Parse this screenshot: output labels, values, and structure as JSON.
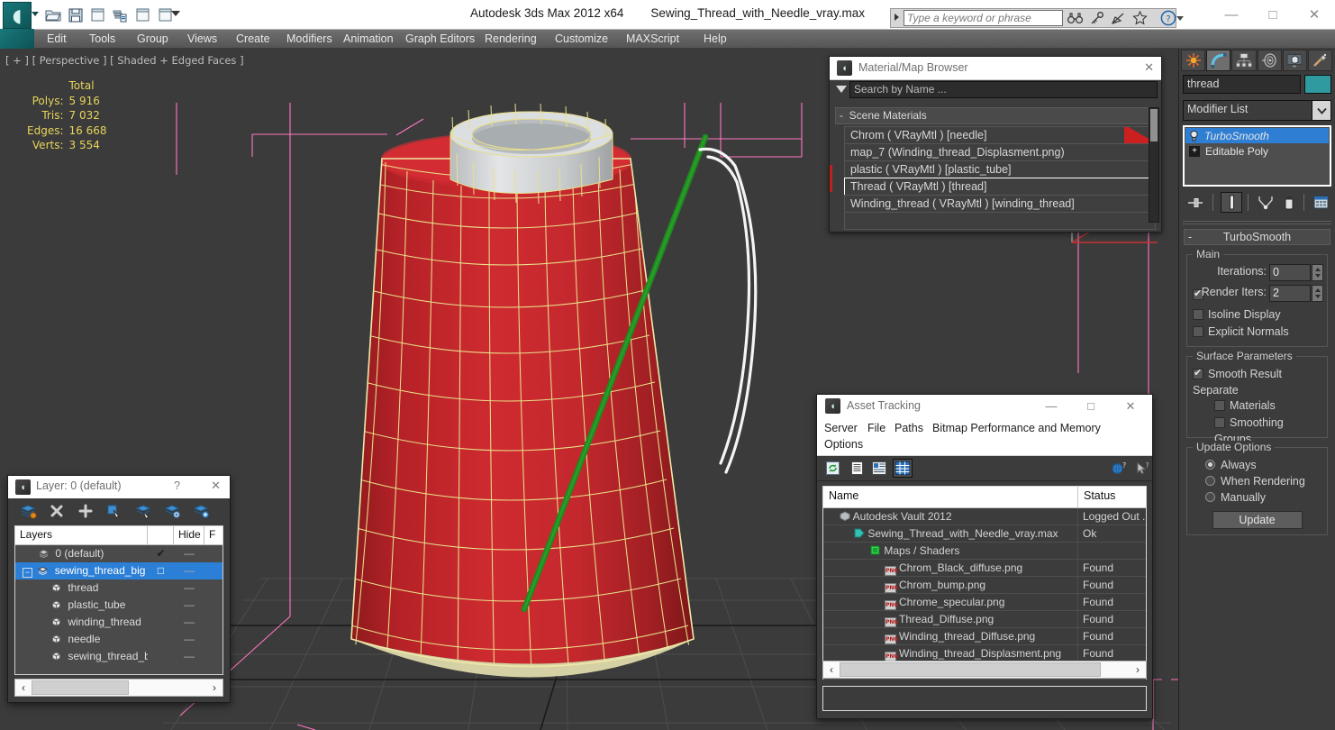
{
  "app": {
    "title": "Autodesk 3ds Max  2012 x64",
    "file": "Sewing_Thread_with_Needle_vray.max",
    "logo_glyph": "ʘ"
  },
  "quick_access": [
    {
      "name": "open-file",
      "label": "open-folder-icon"
    },
    {
      "name": "save-file",
      "label": "save-disk-icon"
    },
    {
      "name": "new-file",
      "label": "new-page-icon"
    },
    {
      "name": "undo",
      "label": "undo-stack-icon"
    },
    {
      "name": "window1",
      "label": "page-icon"
    },
    {
      "name": "window2",
      "label": "page-icon"
    }
  ],
  "search": {
    "placeholder": "Type a keyword or phrase",
    "icons": [
      "binoculars-icon",
      "key-icon",
      "satellite-dish-icon",
      "star-icon",
      "help-icon"
    ]
  },
  "window_buttons": {
    "minimize": "—",
    "maximize": "□",
    "close": "✕"
  },
  "menubar": {
    "items": [
      "Edit",
      "Tools",
      "Group",
      "Views",
      "Create",
      "Modifiers",
      "Animation",
      "Graph Editors",
      "Rendering",
      "Customize",
      "MAXScript",
      "Help"
    ]
  },
  "viewport": {
    "label": "[ + ] [ Perspective ] [ Shaded + Edged Faces ]",
    "stats_header": "Total",
    "stats": [
      {
        "key": "Polys:",
        "value": "5 916"
      },
      {
        "key": "Tris:",
        "value": "7 032"
      },
      {
        "key": "Edges:",
        "value": "16 668"
      },
      {
        "key": "Verts:",
        "value": "3 554"
      }
    ]
  },
  "material_browser": {
    "title": "Material/Map Browser",
    "close": "✕",
    "search_placeholder": "Search by Name ...",
    "group_label": "Scene Materials",
    "group_toggle": "-",
    "materials": [
      {
        "label": "Chrom  ( VRayMtl )  [needle]",
        "selected": false,
        "swatch": "#cc1f1f"
      },
      {
        "label": "map_7 (Winding_thread_Displasment.png)  [winding_thread]",
        "selected": false
      },
      {
        "label": "plastic  ( VRayMtl )  [plastic_tube]",
        "selected": false
      },
      {
        "label": "Thread  ( VRayMtl )  [thread]",
        "selected": true
      },
      {
        "label": "Winding_thread  ( VRayMtl )  [winding_thread]",
        "selected": false
      }
    ]
  },
  "asset_tracking": {
    "title": "Asset Tracking",
    "minimize": "—",
    "maximize": "□",
    "close": "✕",
    "menu": [
      "Server",
      "File",
      "Paths",
      "Bitmap Performance and Memory",
      "Options"
    ],
    "toolbar": [
      "refresh-icon",
      "list-view-icon",
      "detail-view-icon",
      "grid-view-icon",
      "help-globe-icon",
      "help-arrow-icon"
    ],
    "columns": [
      "Name",
      "Status"
    ],
    "rows": [
      {
        "name": "Autodesk Vault 2012",
        "status": "Logged Out ...",
        "indent": 1,
        "icon": "vault-icon"
      },
      {
        "name": "Sewing_Thread_with_Needle_vray.max",
        "status": "Ok",
        "indent": 2,
        "icon": "max-file-icon"
      },
      {
        "name": "Maps / Shaders",
        "status": "",
        "indent": 3,
        "icon": "maps-icon"
      },
      {
        "name": "Chrom_Black_diffuse.png",
        "status": "Found",
        "indent": 4,
        "icon": "png-icon"
      },
      {
        "name": "Chrom_bump.png",
        "status": "Found",
        "indent": 4,
        "icon": "png-icon"
      },
      {
        "name": "Chrome_specular.png",
        "status": "Found",
        "indent": 4,
        "icon": "png-icon"
      },
      {
        "name": "Thread_Diffuse.png",
        "status": "Found",
        "indent": 4,
        "icon": "png-icon"
      },
      {
        "name": "Winding_thread_Diffuse.png",
        "status": "Found",
        "indent": 4,
        "icon": "png-icon"
      },
      {
        "name": "Winding_thread_Displasment.png",
        "status": "Found",
        "indent": 4,
        "icon": "png-icon"
      }
    ],
    "scroll_left": "‹",
    "scroll_right": "›"
  },
  "layer_panel": {
    "title": "Layer: 0 (default)",
    "help": "?",
    "close": "✕",
    "toolbar": [
      "new-layer-icon",
      "delete-layer-icon",
      "add-layer-icon",
      "select-objects-icon",
      "select-highlight-icon",
      "add-selection-icon",
      "layer-settings-icon"
    ],
    "columns": [
      "Layers",
      "",
      "Hide",
      "F"
    ],
    "rows": [
      {
        "name": "0 (default)",
        "indent": 1,
        "check": "✔",
        "hide": "—",
        "selected": false,
        "expander": ""
      },
      {
        "name": "sewing_thread_big",
        "indent": 1,
        "check": "□",
        "hide": "—",
        "selected": true,
        "expander": "−"
      },
      {
        "name": "thread",
        "indent": 2,
        "check": "",
        "hide": "—",
        "selected": false,
        "expander": ""
      },
      {
        "name": "plastic_tube",
        "indent": 2,
        "check": "",
        "hide": "—",
        "selected": false,
        "expander": ""
      },
      {
        "name": "winding_thread",
        "indent": 2,
        "check": "",
        "hide": "—",
        "selected": false,
        "expander": ""
      },
      {
        "name": "needle",
        "indent": 2,
        "check": "",
        "hide": "—",
        "selected": false,
        "expander": ""
      },
      {
        "name": "sewing_thread_big",
        "indent": 2,
        "check": "",
        "hide": "—",
        "selected": false,
        "expander": ""
      }
    ],
    "scroll_left": "‹",
    "scroll_right": "›"
  },
  "command_panel": {
    "tabs": [
      "create-tab-icon",
      "modify-tab-icon",
      "hierarchy-tab-icon",
      "motion-tab-icon",
      "display-tab-icon",
      "utilities-tab-icon"
    ],
    "active_tab_index": 1,
    "object_name": "thread",
    "object_color": "#2f9aa0",
    "modifier_list_label": "Modifier List",
    "stack": [
      {
        "label": "TurboSmooth",
        "selected": true,
        "icon": "lightbulb-icon"
      },
      {
        "label": "Editable Poly",
        "selected": false,
        "icon": "plus-box-icon"
      }
    ],
    "stack_tools": [
      "pin-stack-icon",
      "show-end-result-icon",
      "make-unique-icon",
      "remove-modifier-icon",
      "configure-sets-icon"
    ],
    "rollup_title": "TurboSmooth",
    "rollup_toggle": "-",
    "main_group": "Main",
    "iterations_label": "Iterations:",
    "iterations_value": "0",
    "render_iters_label": "Render Iters:",
    "render_iters_value": "2",
    "render_iters_checked": true,
    "isoline_label": "Isoline Display",
    "isoline_checked": false,
    "explicit_label": "Explicit Normals",
    "explicit_checked": false,
    "surface_group": "Surface Parameters",
    "smooth_result_label": "Smooth Result",
    "smooth_result_checked": true,
    "separate_label": "Separate",
    "materials_label": "Materials",
    "materials_checked": false,
    "smoothing_groups_label": "Smoothing Groups",
    "smoothing_groups_checked": false,
    "update_group": "Update Options",
    "update_options": [
      {
        "label": "Always",
        "selected": true
      },
      {
        "label": "When Rendering",
        "selected": false
      },
      {
        "label": "Manually",
        "selected": false
      }
    ],
    "update_button": "Update"
  },
  "colors": {
    "accent_blue": "#2e7fd4",
    "thread_red": "#c7262b",
    "wire_yellow": "#e9e08a",
    "needle_green": "#1f8b1f",
    "gizmo_pink": "#ff77c0",
    "viewport_bg": "#3b3b3b"
  }
}
